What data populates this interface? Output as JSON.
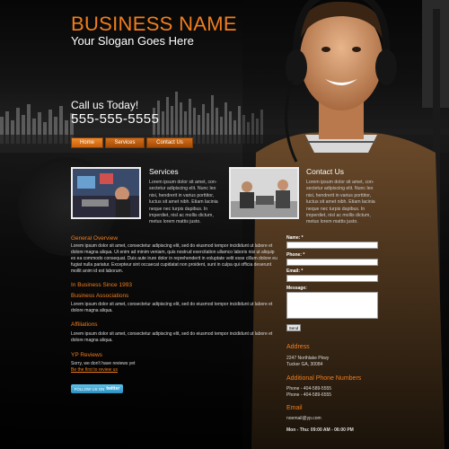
{
  "header": {
    "business_name": "BUSINESS NAME",
    "slogan": "Your Slogan Goes Here",
    "call_label": "Call us Today!",
    "phone": "555-555-5555"
  },
  "nav": {
    "items": [
      {
        "label": "Home"
      },
      {
        "label": "Services"
      },
      {
        "label": "Contact Us"
      }
    ]
  },
  "features": {
    "services": {
      "title": "Services",
      "text": "Lorem ipsum dolor sit amet, con-sectetur adipiscing elit. Nunc leo nisi, hendrerit in varius porttitor, luctus sit amet nibh. Etiam lacinia neque nec turpis dapibus. In imperdiet, nisl ac mollis dictum, metus lorem mattis justo."
    },
    "contact": {
      "title": "Contact Us",
      "text": "Lorem ipsum dolor sit amet, con-sectetur adipiscing elit. Nunc leo nisi, hendrerit in varius porttitor, luctus sit amet nibh. Etiam lacinia neque nec turpis dapibus. In imperdiet, nisl ac mollis dictum, metus lorem mattis justo."
    }
  },
  "main": {
    "general_title": "General Overview",
    "general_text": "Lorem ipsum dolor sit amet, consectetur adipiscing elit, sed do eiusmod tempor incididunt ut labore et dolore magna aliqua. Ut enim ad minim veniam, quis nostrud exercitation ullamco laboris nisi ut aliquip ex ea commodo consequat. Duis aute irure dolor in reprehenderit in voluptate velit esse cillum dolore eu fugiat nulla pariatur. Excepteur sint occaecat cupidatat non proident, sunt in culpa qui officia deserunt mollit anim id est laborum.",
    "since_title": "In Business Since 1993",
    "assoc_title": "Business Associations",
    "assoc_text": "Lorem ipsum dolor sit amet, consectetur adipiscing elit, sed do eiusmod tempor incididunt ut labore et dolore magna aliqua.",
    "affil_title": "Affiliations",
    "affil_text": "Lorem ipsum dolor sit amet, consectetur adipiscing elit, sed do eiusmod tempor incididunt ut labore et dolore magna aliqua.",
    "yp_title": "YP Reviews",
    "yp_text": "Sorry, we don't have reviews yet",
    "yp_link": "Be the first to review us",
    "twitter_label": "FOLLOW US ON",
    "twitter_brand": "twitter"
  },
  "form": {
    "name_label": "Name: *",
    "phone_label": "Phone: *",
    "email_label": "Email: *",
    "message_label": "Message:",
    "send_label": "Send"
  },
  "sidebar": {
    "address_title": "Address",
    "address_line1": "2247 Northlake Pkwy",
    "address_line2": "Tucker GA, 30084",
    "phones_title": "Additional Phone Numbers",
    "phone1": "Phone - 404-589-5555",
    "phone2": "Phone - 404-589-6555",
    "email_title": "Email",
    "email": "noemail@yp.com",
    "hours": "Mon - Thu: 09:00 AM - 06:00 PM"
  },
  "colors": {
    "accent": "#f07d1d",
    "background": "#0d0d0d"
  }
}
